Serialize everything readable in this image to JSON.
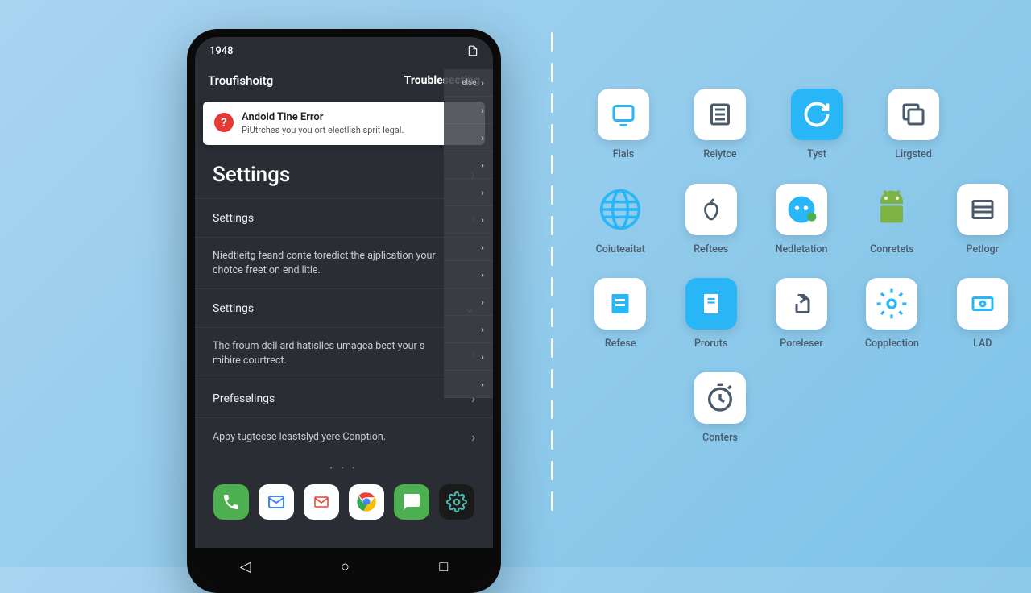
{
  "status": {
    "time": "1948",
    "signal": "▾"
  },
  "tabs": {
    "left": "Troufishoitg",
    "right": "Troublesecting"
  },
  "error": {
    "title": "Andold Tine Error",
    "subtitle": "PiUtrches you you ort electlish sprit legal."
  },
  "settings_heading": "Settings",
  "rows": {
    "r1": "Settings",
    "r2": "Niedtleitg feand conte toredict the ajplication your chotce freet on end litie.",
    "r3": "Settings",
    "r4": "The froum dell ard hatislles umagea bect your s mibire courtrect.",
    "r5": "Prefeselings",
    "r6": "Appy tugtecse leastslyd yere Conption."
  },
  "side": {
    "top_label": "else"
  },
  "grid": {
    "r1": [
      {
        "label": "Flals"
      },
      {
        "label": "Reiytce"
      },
      {
        "label": "Tyst"
      },
      {
        "label": "Lirgsted"
      }
    ],
    "r2": [
      {
        "label": "Coiuteaitat"
      },
      {
        "label": "Reftees"
      },
      {
        "label": "Nedletation"
      },
      {
        "label": "Conretets"
      },
      {
        "label": "Petlogr"
      }
    ],
    "r3": [
      {
        "label": "Refese"
      },
      {
        "label": "Proruts"
      },
      {
        "label": "Poreleser"
      },
      {
        "label": "Copplection"
      },
      {
        "label": "LAD"
      }
    ],
    "r4": [
      {
        "label": "Conters"
      }
    ]
  }
}
